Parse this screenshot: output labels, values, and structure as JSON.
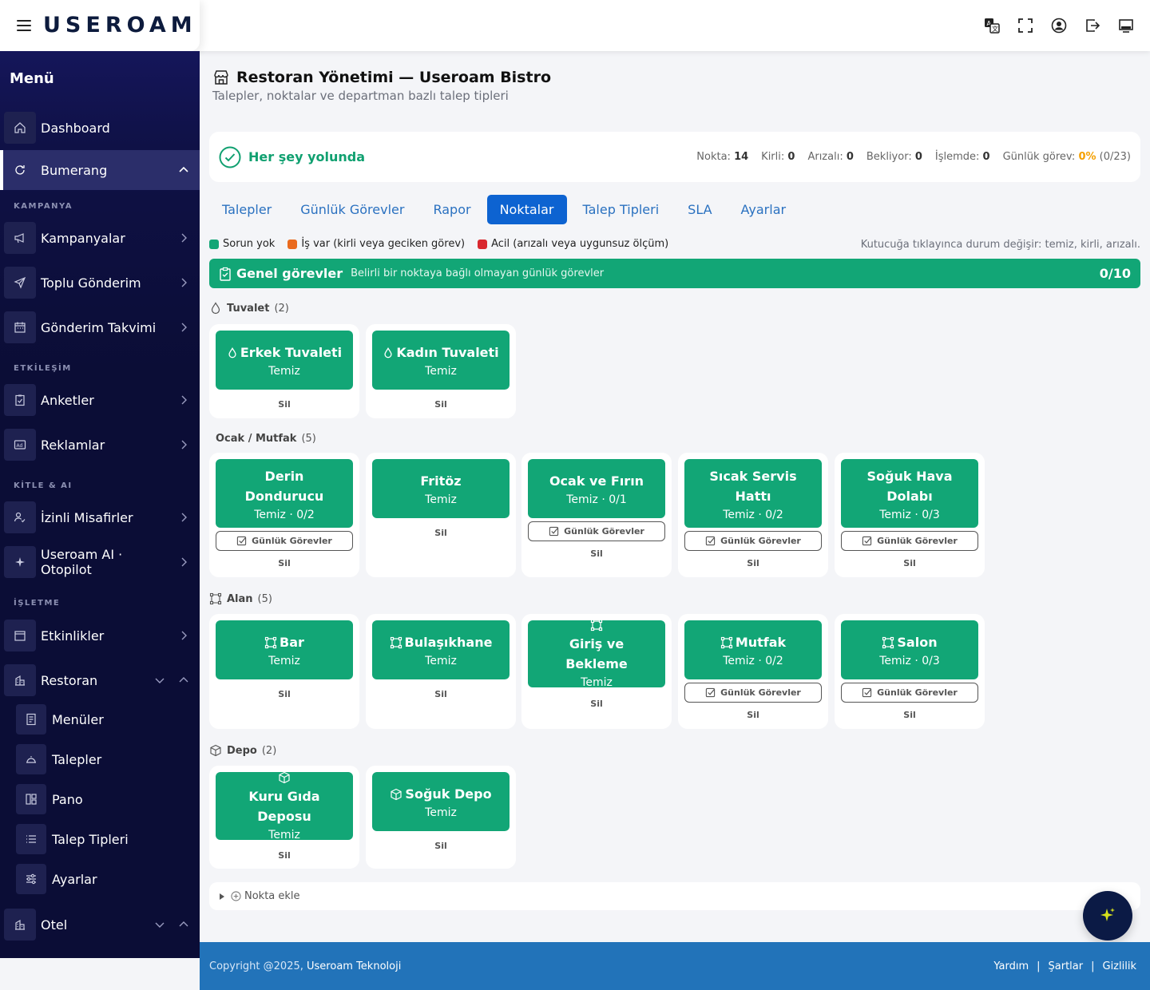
{
  "brand": {
    "logo_text": "USEROAM"
  },
  "topbar": {
    "icons": [
      "translate-icon",
      "fullscreen-icon",
      "account-icon",
      "logout-icon",
      "monitor-icon"
    ]
  },
  "sidebar": {
    "title": "Menü",
    "items": {
      "dashboard": "Dashboard",
      "bumerang": "Bumerang",
      "sec_kampanya": "KAMPANYA",
      "kampanyalar": "Kampanyalar",
      "toplu": "Toplu Gönderim",
      "takvim": "Gönderim Takvimi",
      "sec_etkilesim": "ETKİLEŞİM",
      "anketler": "Anketler",
      "reklamlar": "Reklamlar",
      "sec_kitle": "KİTLE & AI",
      "izinli": "İzinli Misafirler",
      "ai": "Useroam AI · Otopilot",
      "sec_isletme": "İŞLETME",
      "etkinlikler": "Etkinlikler",
      "restoran": "Restoran",
      "menuler": "Menüler",
      "talepler": "Talepler",
      "pano": "Pano",
      "talep_tipleri": "Talep Tipleri",
      "ayarlar": "Ayarlar",
      "otel": "Otel"
    }
  },
  "page": {
    "title": "Restoran Yönetimi — Useroam Bistro",
    "subtitle": "Talepler, noktalar ve departman bazlı talep tipleri"
  },
  "status": {
    "label": "Her şey yolunda",
    "nokta_label": "Nokta:",
    "nokta": "14",
    "kirli_label": "Kirli:",
    "kirli": "0",
    "arizali_label": "Arızalı:",
    "arizali": "0",
    "bekliyor_label": "Bekliyor:",
    "bekliyor": "0",
    "islemde_label": "İşlemde:",
    "islemde": "0",
    "gunluk_label": "Günlük görev:",
    "gunluk_pct": "0%",
    "gunluk_count": "(0/23)"
  },
  "tabs": [
    "Talepler",
    "Günlük Görevler",
    "Rapor",
    "Noktalar",
    "Talep Tipleri",
    "SLA",
    "Ayarlar"
  ],
  "active_tab": "Noktalar",
  "legend": {
    "ok": "Sorun yok",
    "ok_color": "#12a676",
    "work": "İş var (kirli veya geciken görev)",
    "work_color": "#ea6a1e",
    "urgent": "Acil (arızalı veya uygunsuz ölçüm)",
    "urgent_color": "#d9282f",
    "hint": "Kutucuğa tıklayınca durum değişir: temiz, kirli, arızalı."
  },
  "general": {
    "title": "Genel görevler",
    "subtitle": "Belirli bir noktaya bağlı olmayan günlük görevler",
    "count": "0/10"
  },
  "groups": {
    "tuvalet": {
      "name": "Tuvalet",
      "count": "(2)",
      "cards": [
        {
          "name": "Erkek Tuvaleti",
          "status": "Temiz",
          "delete": "Sil"
        },
        {
          "name": "Kadın Tuvaleti",
          "status": "Temiz",
          "delete": "Sil"
        }
      ]
    },
    "ocak": {
      "name": "Ocak / Mutfak",
      "count": "(5)",
      "cards": [
        {
          "name": "Derin Dondurucu",
          "status": "Temiz · 0/2",
          "tasks": "Günlük Görevler",
          "delete": "Sil"
        },
        {
          "name": "Fritöz",
          "status": "Temiz",
          "delete": "Sil"
        },
        {
          "name": "Ocak ve Fırın",
          "status": "Temiz · 0/1",
          "tasks": "Günlük Görevler",
          "delete": "Sil"
        },
        {
          "name": "Sıcak Servis Hattı",
          "status": "Temiz · 0/2",
          "tasks": "Günlük Görevler",
          "delete": "Sil"
        },
        {
          "name": "Soğuk Hava Dolabı",
          "status": "Temiz · 0/3",
          "tasks": "Günlük Görevler",
          "delete": "Sil"
        }
      ]
    },
    "alan": {
      "name": "Alan",
      "count": "(5)",
      "cards": [
        {
          "name": "Bar",
          "status": "Temiz",
          "delete": "Sil"
        },
        {
          "name": "Bulaşıkhane",
          "status": "Temiz",
          "delete": "Sil"
        },
        {
          "name": "Giriş ve Bekleme",
          "status": "Temiz",
          "delete": "Sil"
        },
        {
          "name": "Mutfak",
          "status": "Temiz · 0/2",
          "tasks": "Günlük Görevler",
          "delete": "Sil"
        },
        {
          "name": "Salon",
          "status": "Temiz · 0/3",
          "tasks": "Günlük Görevler",
          "delete": "Sil"
        }
      ]
    },
    "depo": {
      "name": "Depo",
      "count": "(2)",
      "cards": [
        {
          "name": "Kuru Gıda Deposu",
          "status": "Temiz",
          "delete": "Sil"
        },
        {
          "name": "Soğuk Depo",
          "status": "Temiz",
          "delete": "Sil"
        }
      ]
    }
  },
  "add_point": "Nokta ekle",
  "footer": {
    "copyright": "Copyright @2025,",
    "company": "Useroam Teknoloji",
    "help": "Yardım",
    "terms": "Şartlar",
    "privacy": "Gizlilik",
    "sep": "|"
  }
}
